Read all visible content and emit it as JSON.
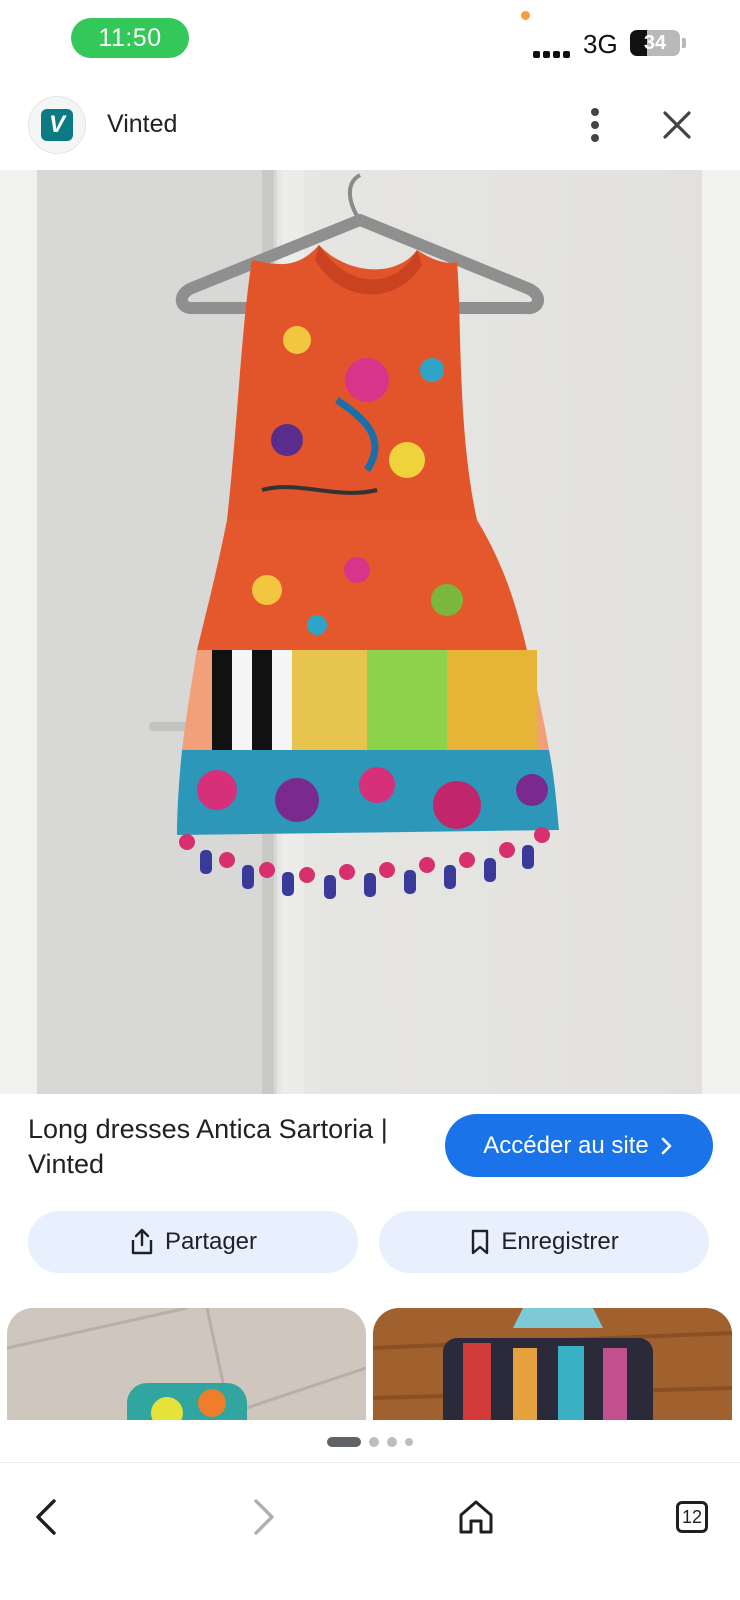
{
  "status_bar": {
    "time": "11:50",
    "network": "3G",
    "battery_percent": "34",
    "battery_level": 0.34
  },
  "site": {
    "logo_letter": "V",
    "name": "Vinted"
  },
  "result": {
    "title": "Long dresses Antica Sartoria | Vinted",
    "visit_label": "Accéder au site"
  },
  "actions": {
    "share_label": "Partager",
    "save_label": "Enregistrer"
  },
  "pager": {
    "count": 4,
    "active": 0
  },
  "nav": {
    "tabs_count": "12",
    "icons": [
      "back-arrow-icon",
      "forward-arrow-icon",
      "home-icon",
      "tabs-icon"
    ]
  },
  "colors": {
    "accent": "#1a73e8",
    "time_pill": "#34c759",
    "logo_tile": "#0b7a82",
    "chip_bg": "#e8f0fe"
  }
}
